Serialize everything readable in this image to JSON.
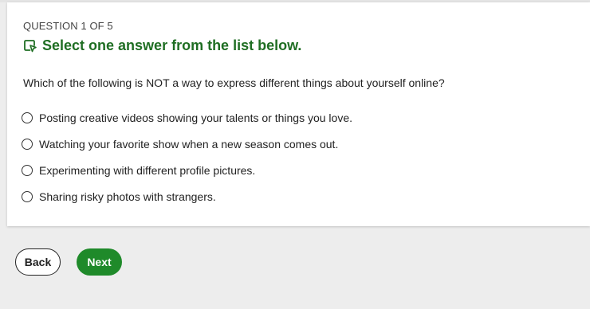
{
  "quiz": {
    "counter": "QUESTION 1 OF 5",
    "instruction": "Select one answer from the list below.",
    "question": "Which of the following is NOT a way to express different things about yourself online?",
    "options": [
      {
        "label": "Posting creative videos showing your talents or things you love."
      },
      {
        "label": "Watching your favorite show when a new season comes out."
      },
      {
        "label": "Experimenting with different profile pictures."
      },
      {
        "label": "Sharing risky photos with strangers."
      }
    ]
  },
  "nav": {
    "back_label": "Back",
    "next_label": "Next"
  },
  "colors": {
    "accent_green": "#1f6e23",
    "button_green": "#1f8a2a",
    "background": "#ededed"
  },
  "icons": {
    "instruction": "pointer-select-icon"
  }
}
